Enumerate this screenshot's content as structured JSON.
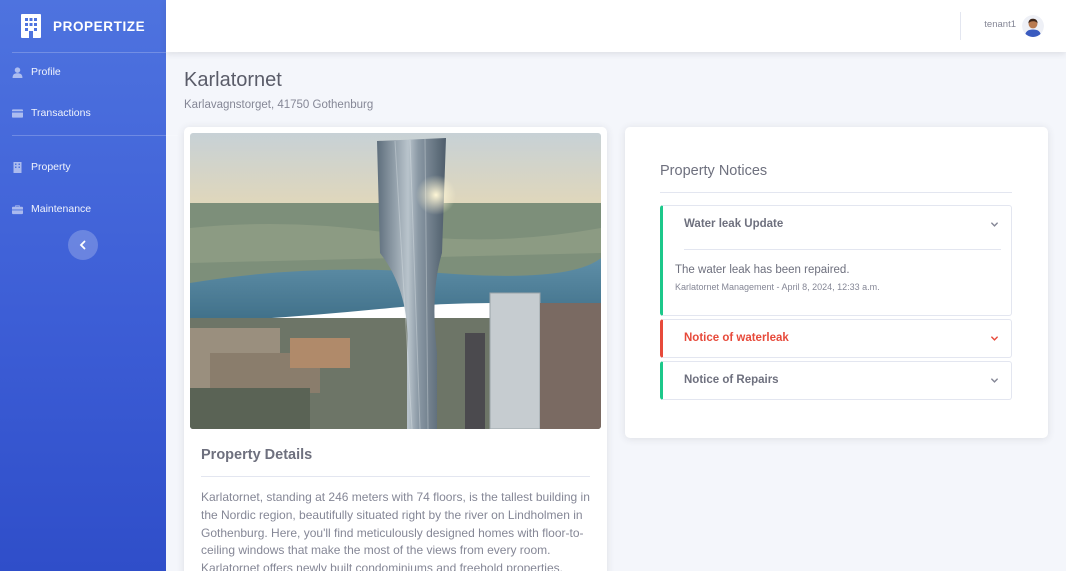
{
  "brand": {
    "name": "PROPERTIZE"
  },
  "sidebar": {
    "items": [
      {
        "label": "Profile",
        "icon": "user-icon"
      },
      {
        "label": "Transactions",
        "icon": "credit-card-icon"
      },
      {
        "label": "Property",
        "icon": "building-icon"
      },
      {
        "label": "Maintenance",
        "icon": "toolbox-icon"
      }
    ],
    "toggle_icon": "chevron-left-icon"
  },
  "topbar": {
    "username": "tenant1",
    "avatar_icon": "user-avatar"
  },
  "property": {
    "name": "Karlatornet",
    "address": "Karlavagnstorget, 41750 Gothenburg",
    "details_title": "Property Details",
    "description": "Karlatornet, standing at 246 meters with 74 floors, is the tallest building in the Nordic region, beautifully situated right by the river on Lindholmen in Gothenburg. Here, you'll find meticulously designed homes with floor-to-ceiling windows that make the most of the views from every room. Karlatornet offers newly built condominiums and freehold properties."
  },
  "notices": {
    "title": "Property Notices",
    "items": [
      {
        "title": "Water leak Update",
        "status": "success",
        "expanded": true,
        "message": "The water leak has been repaired.",
        "meta": "Karlatornet Management - April 8, 2024, 12:33 a.m."
      },
      {
        "title": "Notice of waterleak",
        "status": "danger",
        "expanded": false
      },
      {
        "title": "Notice of Repairs",
        "status": "success",
        "expanded": false
      }
    ]
  },
  "colors": {
    "primary": "#4e73df",
    "success": "#1cc88a",
    "danger": "#e74a3b",
    "text": "#5a5c69",
    "muted": "#858796"
  }
}
